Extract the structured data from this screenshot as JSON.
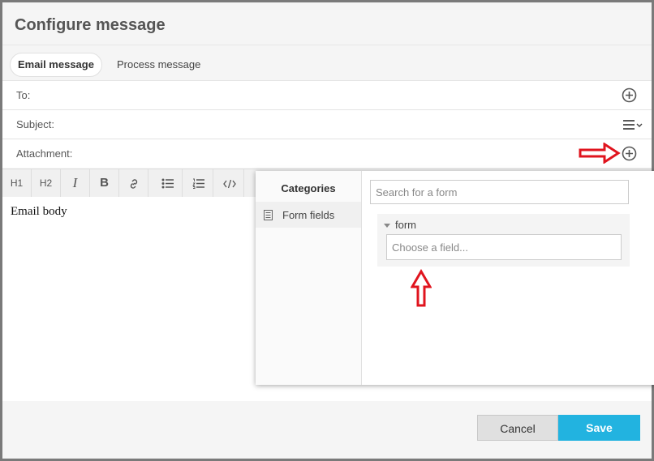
{
  "dialog": {
    "title": "Configure message"
  },
  "tabs": [
    {
      "label": "Email message",
      "active": true
    },
    {
      "label": "Process message",
      "active": false
    }
  ],
  "fields": {
    "to_label": "To:",
    "subject_label": "Subject:",
    "attachment_label": "Attachment:"
  },
  "toolbar": {
    "h1": "H1",
    "h2": "H2",
    "italic": "I",
    "bold": "B",
    "link_icon": "link-icon",
    "bullet_icon": "bullet-list-icon",
    "number_icon": "numbered-list-icon",
    "code_icon": "code-icon"
  },
  "editor": {
    "body_text": "Email body"
  },
  "popup": {
    "categories_heading": "Categories",
    "category_items": [
      {
        "label": "Form fields",
        "icon": "document-icon"
      }
    ],
    "search_placeholder": "Search for a form",
    "form_group": "form",
    "field_placeholder": "Choose a field..."
  },
  "footer": {
    "cancel_label": "Cancel",
    "save_label": "Save"
  },
  "colors": {
    "accent": "#22b3e0",
    "annotation_arrow": "#e0141e"
  }
}
